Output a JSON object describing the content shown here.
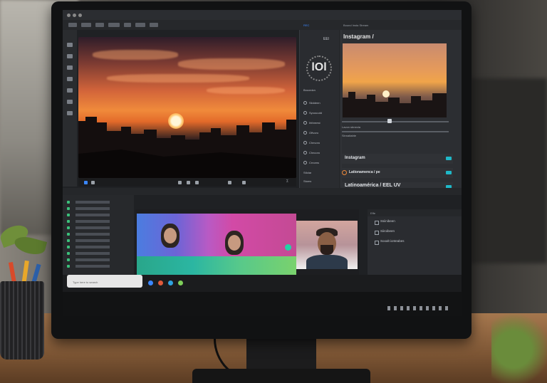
{
  "scene": {
    "description_colors": {
      "desk": "#a5774e",
      "monitor": "#111213",
      "screen_bg": "#1f2124"
    }
  },
  "app": {
    "right_panel": {
      "subtitle": "Bound Insta Stream",
      "title": "Instagram /",
      "rows": [
        {
          "label": "Instagram",
          "toggle_color": "#1fb8c8"
        },
        {
          "label": "Lationamenca / pe",
          "toggle_color": "#1fb8c8"
        },
        {
          "label": "Latinoamérica / EEL UV",
          "toggle_color": "#1fb8c8"
        }
      ],
      "slider_labels": [
        "Lavon sbnecta",
        "Sinnaitabte"
      ]
    },
    "center_panel": {
      "header_badge": "REC",
      "corner_badge": "EEl",
      "logo_text": "lOl",
      "items": [
        "Brocedvn",
        "Siiddeen",
        "Syoouudd",
        "Ihthreest",
        "Oftvoro",
        "Chnvoro",
        "Chncoro",
        "Crnoms",
        "Stlolar",
        "Stoms"
      ]
    },
    "viewer": {
      "right_indicator": "Σ"
    },
    "properties": {
      "header": "Effe",
      "items": [
        "Ssiinibeen",
        "Siiroibeen",
        "Sooalt ionteabes"
      ]
    },
    "layers": {
      "count_rows": 11
    },
    "taskbar": {
      "search_placeholder": "Type here to search",
      "icon_colors": [
        "#3a86ff",
        "#e05a3a",
        "#2fa3e0",
        "#7fcf5a"
      ]
    },
    "colors": {
      "accent": "#1fb8c8",
      "play": "#3a86ff",
      "clip_green": "#22d3a6"
    }
  }
}
